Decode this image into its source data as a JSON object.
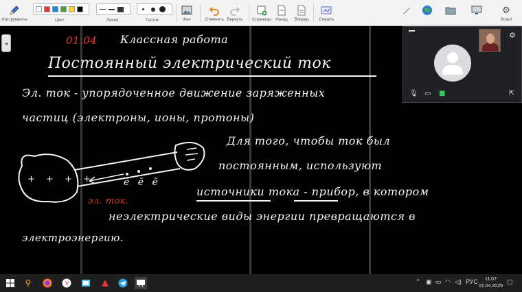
{
  "toolbar": {
    "tools_label": "Инструменты",
    "color_label": "Цвет",
    "line_label": "Линия",
    "eraser_label": "Ластик",
    "background_label": "Фон",
    "undo_label": "Отменить",
    "redo_label": "Вернуть",
    "pages_label": "Страницы",
    "back_label": "Назад",
    "forward_label": "Вперед",
    "erase_label": "Стереть",
    "board_label": "Board",
    "colors": [
      "#ffffff",
      "#e53935",
      "#1e88e5",
      "#43a047",
      "#fdd835",
      "#000000"
    ]
  },
  "board": {
    "lines": [
      "01.04",
      "Классная работа",
      "Постоянный электрический ток",
      "Эл. ток - упорядоченное движение заряженных",
      "частиц (электроны, ионы, протоны)",
      "Для того, чтобы ток был",
      "постоянным, используют",
      "источники тока - прибор, в котором",
      "неэлектрические виды энергии превращаются в",
      "электроэнергию.",
      "эл. ток."
    ],
    "diagram_charges": "+ + + +",
    "diagram_electrons": "ē ē ē"
  },
  "call": {
    "settings_icon": "gear-icon",
    "mic_icon": "mic-icon",
    "camera_icon": "camera-icon",
    "share_icon": "share-screen-icon",
    "leave_icon": "exit-icon"
  },
  "taskbar": {
    "language": "РУС",
    "time": "11:07",
    "date": "01.04.2025"
  }
}
